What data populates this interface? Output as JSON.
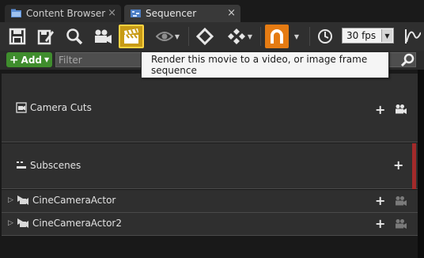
{
  "tabs": [
    {
      "label": "Content Browser",
      "close": "×"
    },
    {
      "label": "Sequencer",
      "close": "×"
    }
  ],
  "toolbar": {
    "fps_value": "30 fps",
    "fps_arrow": "▼",
    "caret": "▼"
  },
  "filter": {
    "add_label": "Add",
    "add_plus": "+",
    "placeholder": "Filter"
  },
  "tooltip": {
    "text": "Render this movie to a video, or image frame sequence"
  },
  "tracks": [
    {
      "label": "Camera Cuts",
      "plus": "+"
    },
    {
      "label": "Subscenes",
      "plus": "+"
    },
    {
      "label": "CineCameraActor",
      "plus": "+",
      "expander": "▷"
    },
    {
      "label": "CineCameraActor2",
      "plus": "+",
      "expander": "▷"
    }
  ],
  "colors": {
    "render_button": "#c89b16",
    "render_border": "#ffd340",
    "magnet_button": "#e57b12",
    "add_button": "#3f8d2d",
    "subscene_accent": "#a22a2a"
  }
}
